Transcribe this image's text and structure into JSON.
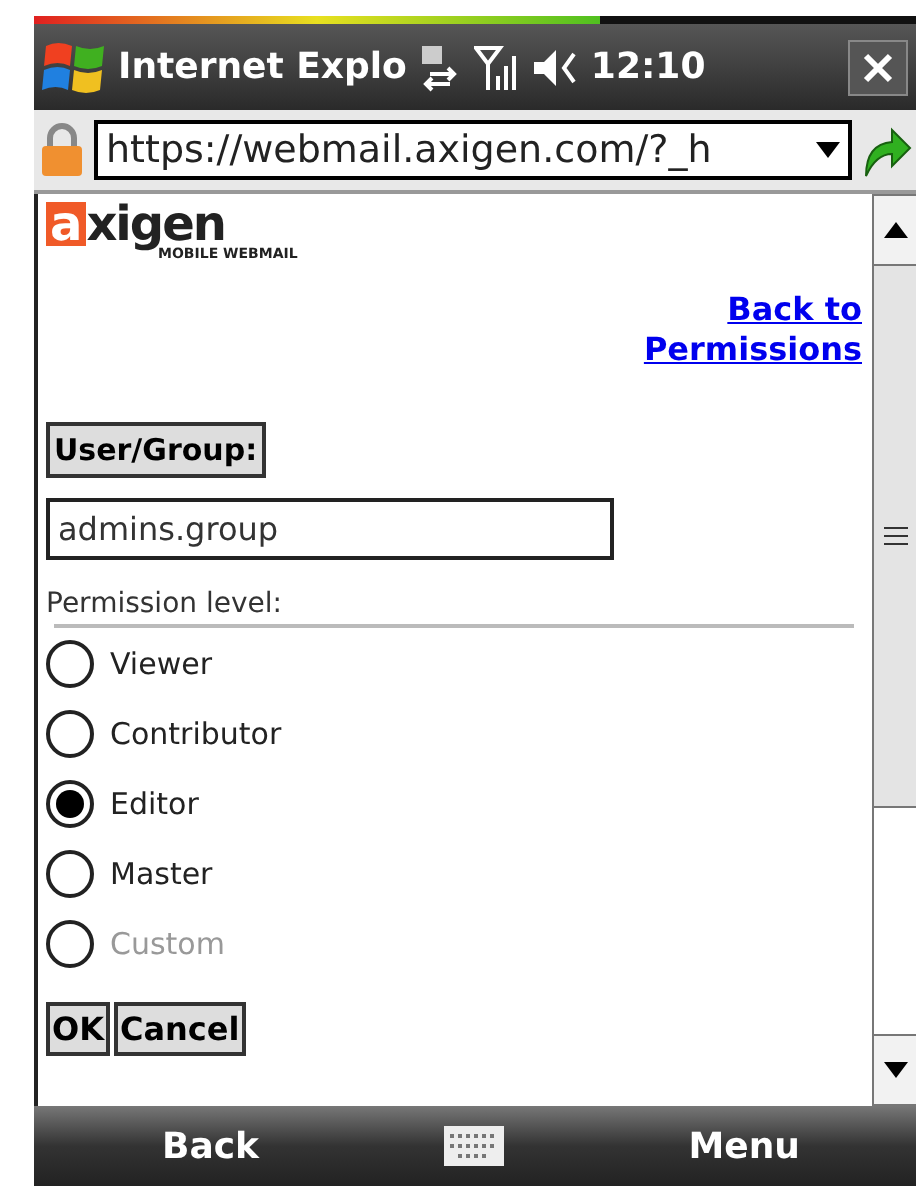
{
  "status_bar": {
    "title": "Internet Explo",
    "time": "12:10"
  },
  "address_bar": {
    "url": "https://webmail.axigen.com/?_h"
  },
  "logo": {
    "mark": "a",
    "name": "xigen",
    "tagline": "MOBILE WEBMAIL"
  },
  "back_link": "Back to Permissions",
  "user_group": {
    "label": "User/Group:",
    "value": "admins.group"
  },
  "permission_level": {
    "label": "Permission level:",
    "options": [
      {
        "label": "Viewer",
        "selected": false,
        "disabled": false
      },
      {
        "label": "Contributor",
        "selected": false,
        "disabled": false
      },
      {
        "label": "Editor",
        "selected": true,
        "disabled": false
      },
      {
        "label": "Master",
        "selected": false,
        "disabled": false
      },
      {
        "label": "Custom",
        "selected": false,
        "disabled": true
      }
    ]
  },
  "buttons": [
    "OK",
    "Cancel"
  ],
  "softkeys": {
    "left": "Back",
    "right": "Menu"
  }
}
